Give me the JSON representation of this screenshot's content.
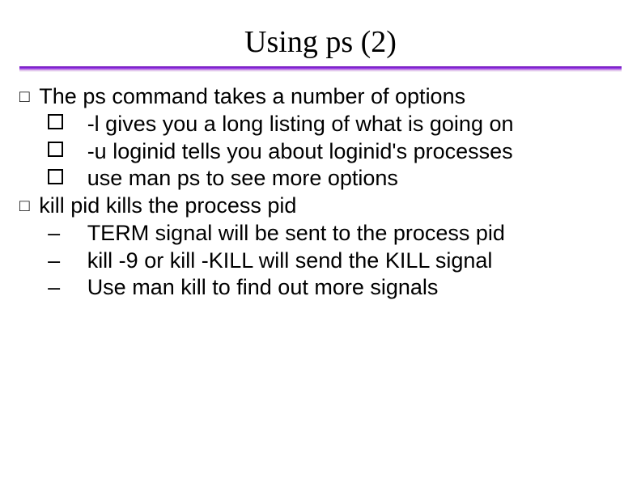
{
  "title": "Using ps (2)",
  "items": [
    {
      "bullet": "square-outline",
      "runs": [
        "The ",
        "ps",
        " command takes a number of options"
      ],
      "children": [
        {
          "bullet": "square-thick",
          "runs": [
            "-l  gives you a long listing of what is going on"
          ]
        },
        {
          "bullet": "square-thick",
          "runs": [
            "-u loginid  tells you about loginid's processes"
          ]
        },
        {
          "bullet": "square-thick",
          "runs": [
            "use ",
            "man ps",
            " to see more options"
          ]
        }
      ]
    },
    {
      "bullet": "square-outline",
      "runs": [
        "kill pid",
        "  kills the process pid"
      ],
      "children": [
        {
          "bullet": "dash",
          "runs": [
            "TERM signal will be sent to the process pid"
          ]
        },
        {
          "bullet": "dash",
          "runs": [
            "kill -9 or kill -KILL will send the KILL signal"
          ]
        },
        {
          "bullet": "dash",
          "runs": [
            "Use ",
            "man kill",
            " to find out more signals"
          ]
        }
      ]
    }
  ]
}
